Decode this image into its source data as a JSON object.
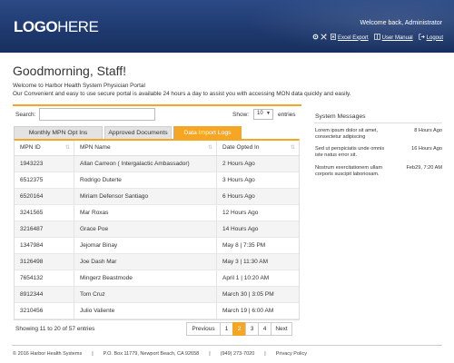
{
  "header": {
    "logo_bold": "LOGO",
    "logo_light": "HERE",
    "welcome": "Welcome back, Administrator",
    "links": {
      "excel_export": "Excel Export",
      "user_manual": "User Manual",
      "logout": "Logout"
    },
    "icons": [
      "gear-icon",
      "tools-icon",
      "excel-icon",
      "manual-icon",
      "logout-icon"
    ]
  },
  "greeting": {
    "title": "Goodmorning, Staff!",
    "line1": "Welcome to Harbor Health System Physician Portal",
    "line2": "Our Convenient and easy to use secure portal is available 24 hours a day to assist you with accessing MON data quickly and easily."
  },
  "controls": {
    "search_label": "Search:",
    "search_value": "",
    "show_label": "Show:",
    "show_value": "10",
    "entries_label": "entries"
  },
  "tabs": [
    {
      "label": "Monthly MPN Opt Ins",
      "active": false
    },
    {
      "label": "Approved Documents",
      "active": false
    },
    {
      "label": "Data Import Logs",
      "active": true
    }
  ],
  "table": {
    "columns": [
      "MPN ID",
      "MPN Name",
      "Date Opted In"
    ],
    "rows": [
      [
        "1943223",
        "Allan Carreon ( Intergalactic Ambassador)",
        "2 Hours Ago"
      ],
      [
        "6512375",
        "Rodrigo Duterte",
        "3 Hours Ago"
      ],
      [
        "6520164",
        "Miriam Defensor Santiago",
        "6 Hours Ago"
      ],
      [
        "3241565",
        "Mar Roxas",
        "12 Hours Ago"
      ],
      [
        "3216487",
        "Grace Poe",
        "14 Hours Ago"
      ],
      [
        "1347984",
        "Jejomar Binay",
        "May 8  |  7:35 PM"
      ],
      [
        "3126498",
        "Joe Dash Mar",
        "May 3  |  11:30 AM"
      ],
      [
        "7654132",
        "Mingerz Beastmode",
        "April 1  |  10:20 AM"
      ],
      [
        "8912344",
        "Tom Cruz",
        "March 30  |  3:05 PM"
      ],
      [
        "3210456",
        "Julio Valiente",
        "March 19  |  6:00 AM"
      ]
    ]
  },
  "pagination": {
    "showing": "Showing 11 to 20 of 57 entries",
    "prev": "Previous",
    "pages": [
      "1",
      "2",
      "3",
      "4"
    ],
    "active_page": "2",
    "next": "Next"
  },
  "system_messages": {
    "title": "System Messages",
    "items": [
      {
        "text": "Lorem ipsum dolor sit amet, consectetur adipiscing",
        "time": "8 Hours Ago"
      },
      {
        "text": "Sed ut perspiciatis unde omnis iste natus error sit.",
        "time": "16 Hours Ago"
      },
      {
        "text": "Nostrum exercitationem ullam corporis suscipit laboriosam.",
        "time": "Feb29, 7:20 AM"
      }
    ]
  },
  "footer": {
    "copyright": "© 2016 Harbor Health Systems",
    "address": "P.O. Box 11779, Newport Beach, CA 92658",
    "phone": "(949) 273-7020",
    "privacy": "Privacy Policy",
    "separator": "|"
  },
  "colors": {
    "accent": "#f5a623",
    "header_bg": "#1f3a70"
  }
}
